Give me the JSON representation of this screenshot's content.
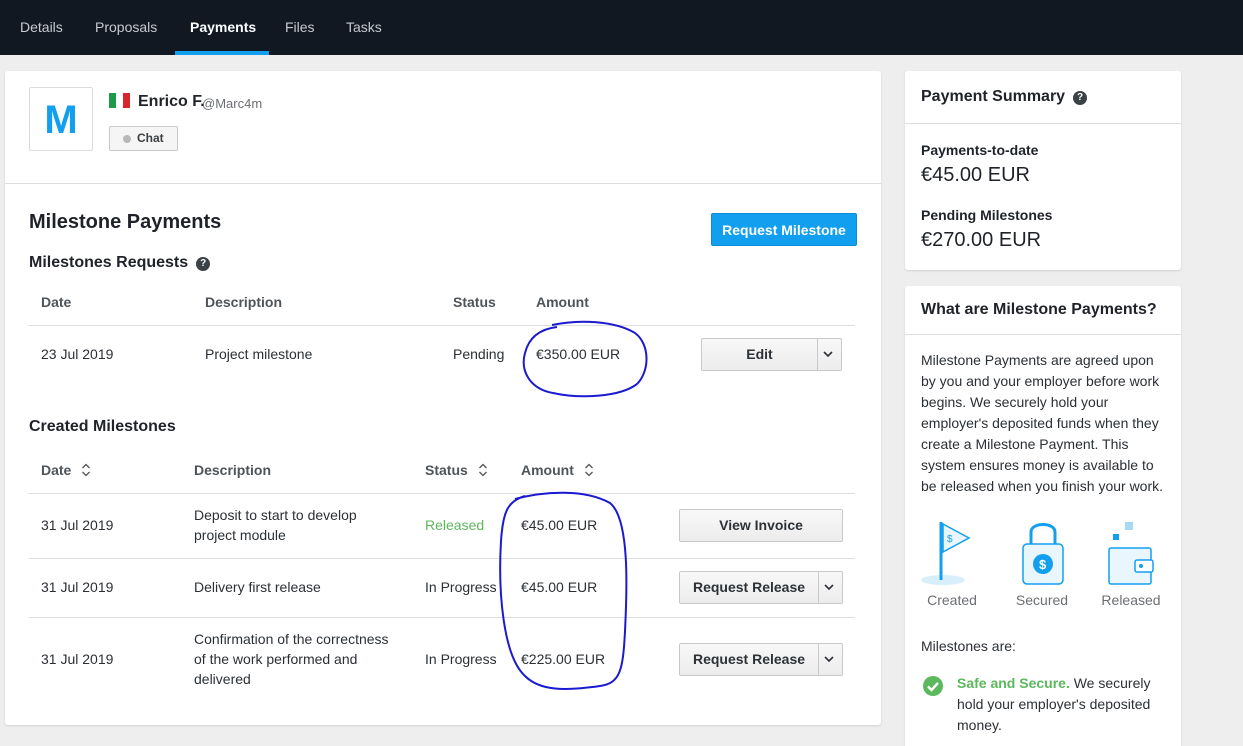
{
  "nav": {
    "tabs": [
      {
        "label": "Details"
      },
      {
        "label": "Proposals"
      },
      {
        "label": "Payments"
      },
      {
        "label": "Files"
      },
      {
        "label": "Tasks"
      }
    ],
    "active_tab": "Payments"
  },
  "profile": {
    "avatar_letter": "M",
    "name": "Enrico F.",
    "handle": "@Marc4m",
    "chat_label": "Chat"
  },
  "milestones": {
    "title": "Milestone Payments",
    "request_button": "Request Milestone",
    "requests_title": "Milestones Requests",
    "requests_columns": [
      "Date",
      "Description",
      "Status",
      "Amount"
    ],
    "requests_rows": [
      {
        "date": "23 Jul 2019",
        "description": "Project milestone",
        "status": "Pending",
        "amount": "€350.00 EUR",
        "action": "Edit"
      }
    ],
    "created_title": "Created Milestones",
    "created_columns": [
      "Date",
      "Description",
      "Status",
      "Amount"
    ],
    "created_rows": [
      {
        "date": "31 Jul 2019",
        "description": "Deposit to start to develop project module",
        "status": "Released",
        "amount": "€45.00 EUR",
        "action": "View Invoice"
      },
      {
        "date": "31 Jul 2019",
        "description": "Delivery first release",
        "status": "In Progress",
        "amount": "€45.00 EUR",
        "action": "Request Release"
      },
      {
        "date": "31 Jul 2019",
        "description": "Confirmation of the correctness of the work performed and delivered",
        "status": "In Progress",
        "amount": "€225.00 EUR",
        "action": "Request Release"
      }
    ]
  },
  "summary": {
    "title": "Payment Summary",
    "to_date_label": "Payments-to-date",
    "to_date_value": "€45.00 EUR",
    "pending_label": "Pending Milestones",
    "pending_value": "€270.00 EUR"
  },
  "info": {
    "title": "What are Milestone Payments?",
    "body": "Milestone Payments are agreed upon by you and your employer before work begins. We securely hold your employer's deposited funds when they create a Milestone Payment. This system ensures money is available to be released when you finish your work.",
    "steps": [
      {
        "label": "Created",
        "icon": "flag-icon"
      },
      {
        "label": "Secured",
        "icon": "lock-icon"
      },
      {
        "label": "Released",
        "icon": "wallet-icon"
      }
    ],
    "milestones_are": "Milestones are:",
    "safe_strong": "Safe and Secure.",
    "safe_text": " We securely hold your employer's deposited money."
  },
  "colors": {
    "nav_bg": "#111822",
    "accent": "#139ff0",
    "released": "#5cb85c",
    "annotation_ink": "#1a1ad0"
  }
}
